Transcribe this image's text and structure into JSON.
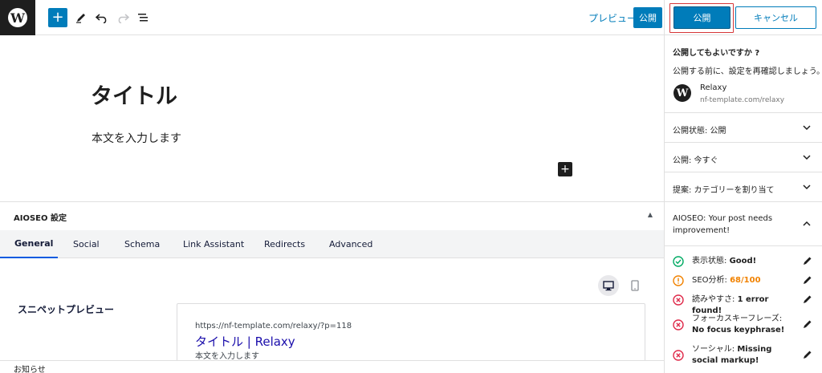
{
  "toolbar": {
    "preview_label": "プレビュー",
    "publish_label": "公開"
  },
  "editor": {
    "title": "タイトル",
    "body": "本文を入力します"
  },
  "aioseo_box": {
    "title": "AIOSEO 設定",
    "tabs": [
      {
        "label": "General"
      },
      {
        "label": "Social"
      },
      {
        "label": "Schema"
      },
      {
        "label": "Link Assistant"
      },
      {
        "label": "Redirects"
      },
      {
        "label": "Advanced"
      }
    ],
    "snippet_label": "スニペットプレビュー",
    "snippet": {
      "url": "https://nf-template.com/relaxy/?p=118",
      "title": "タイトル | Relaxy",
      "description": "本文を入力します"
    }
  },
  "notices": {
    "label": "お知らせ"
  },
  "sidebar": {
    "publish_label": "公開",
    "cancel_label": "キャンセル",
    "confirm_title": "公開してもよいですか ?",
    "confirm_text": "公開する前に、設定を再確認しましょう。",
    "site_name": "Relaxy",
    "site_url": "nf-template.com/relaxy",
    "rows": [
      {
        "label": "公開状態: 公開"
      },
      {
        "label": "公開: 今すぐ"
      },
      {
        "label": "提案: カテゴリーを割り当て"
      }
    ],
    "aioseo_prefix": "AIOSEO:",
    "aioseo_message": "Your post needs improvement!",
    "checks": [
      {
        "label": "表示状態:",
        "value": "Good!",
        "status": "good",
        "color": "#00aa63"
      },
      {
        "label": "SEO分析:",
        "value": "68/100",
        "status": "warning",
        "color": "#f18200"
      },
      {
        "label": "読みやすさ:",
        "value": "1 error found!",
        "status": "error",
        "color": "#df2a4a"
      },
      {
        "label": "フォーカスキーフレーズ:",
        "value": "No focus keyphrase!",
        "status": "error",
        "color": "#df2a4a"
      },
      {
        "label": "ソーシャル:",
        "value": "Missing social markup!",
        "status": "error",
        "color": "#df2a4a"
      }
    ]
  },
  "colors": {
    "accent": "#007cba",
    "highlight_outline": "#d63638"
  }
}
